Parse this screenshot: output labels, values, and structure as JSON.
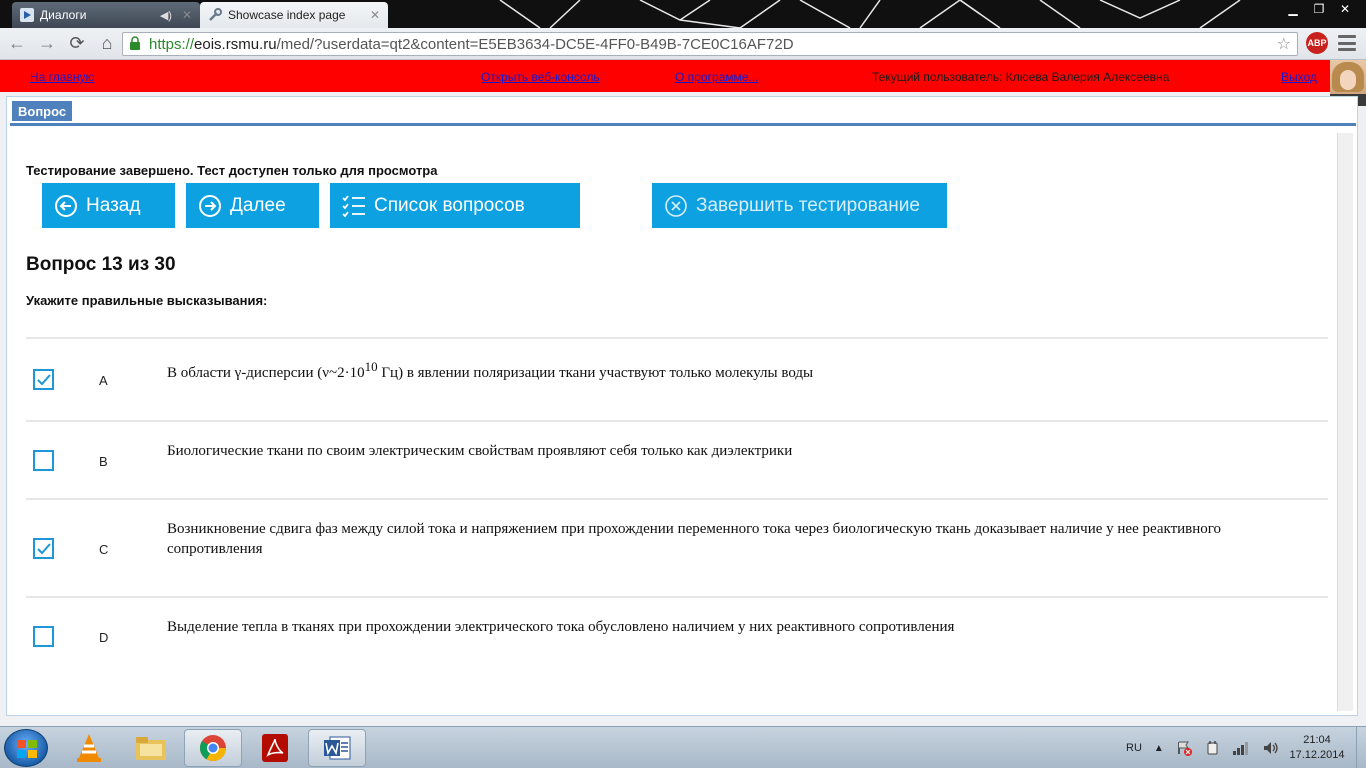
{
  "browser": {
    "tabs": [
      {
        "title": "Диалоги",
        "active": false
      },
      {
        "title": "Showcase index page",
        "active": true
      }
    ],
    "url": {
      "protocol": "https://",
      "host": "eois.rsmu.ru",
      "path": "/med/?userdata=qt2&content=E5EB3634-DC5E-4FF0-B49B-7CE0C16AF72D"
    },
    "adblock_label": "ABP"
  },
  "topbar": {
    "home_link": "На главную",
    "console_link": "Открыть веб-консоль",
    "about_link": "О программе...",
    "user_text": "Текущий пользователь: Клюева Валерия Алексеевна",
    "logout_link": "Выход"
  },
  "panel": {
    "tab_label": "Вопрос",
    "status_message": "Тестирование завершено. Тест доступен только для просмотра",
    "buttons": {
      "back": "Назад",
      "next": "Далее",
      "question_list": "Список вопросов",
      "finish": "Завершить тестирование"
    },
    "question_title": "Вопрос 13 из 30",
    "question_prompt": "Укажите правильные высказывания:",
    "answers": [
      {
        "letter": "A",
        "checked": true,
        "text_before": "В области γ-дисперсии (ν~2·10",
        "sup": "10",
        "text_after": " Гц) в явлении поляризации ткани участвуют только молекулы воды"
      },
      {
        "letter": "B",
        "checked": false,
        "text": "Биологические ткани по своим электрическим свойствам проявляют себя только как диэлектрики"
      },
      {
        "letter": "C",
        "checked": true,
        "text": "Возникновение сдвига фаз между силой тока и напряжением при прохождении переменного тока через биологическую ткань доказывает наличие у нее реактивного сопротивления"
      },
      {
        "letter": "D",
        "checked": false,
        "text": "Выделение тепла в тканях при прохождении электрического тока обусловлено наличием у них реактивного сопротивления"
      }
    ]
  },
  "taskbar": {
    "language": "RU",
    "time": "21:04",
    "date": "17.12.2014"
  },
  "colors": {
    "accent_blue": "#0ea1e2",
    "topbar_red": "#ff0000",
    "panel_blue": "#4f81bd"
  }
}
